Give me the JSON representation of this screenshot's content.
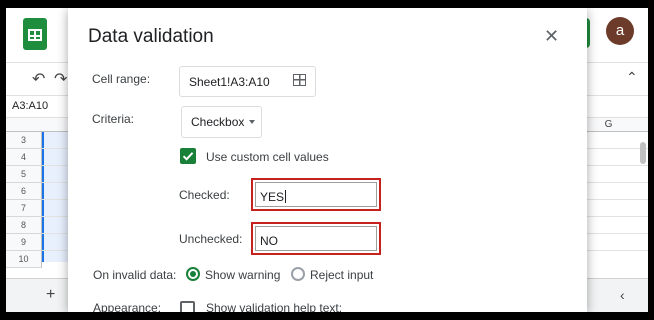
{
  "spreadsheet": {
    "avatar_letter": "a",
    "name_box": "A3:A10",
    "column_g": "G",
    "row_numbers": [
      "3",
      "4",
      "5",
      "6",
      "7",
      "8",
      "9",
      "10"
    ],
    "add_sheet_label": "+",
    "brand_color": "#1e8e3e"
  },
  "dialog": {
    "title": "Data validation",
    "close_icon": "close-icon",
    "cell_range_label": "Cell range:",
    "cell_range_value": "Sheet1!A3:A10",
    "criteria_label": "Criteria:",
    "criteria_value": "Checkbox",
    "use_custom_label": "Use custom cell values",
    "use_custom_checked": true,
    "checked_label": "Checked:",
    "checked_value": "YES",
    "unchecked_label": "Unchecked:",
    "unchecked_value": "NO",
    "on_invalid_label": "On invalid data:",
    "show_warning_label": "Show warning",
    "reject_input_label": "Reject input",
    "appearance_label": "Appearance:",
    "help_text_label": "Show validation help text:",
    "highlight_color": "#c5221f",
    "accent_color": "#188038"
  }
}
